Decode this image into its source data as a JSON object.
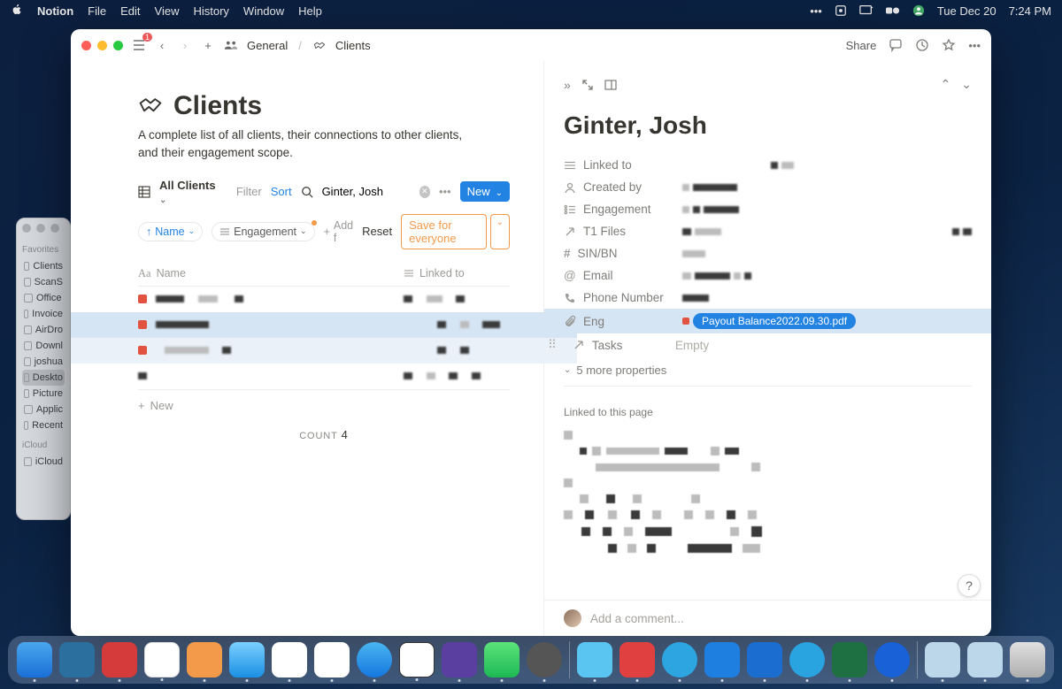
{
  "menubar": {
    "app": "Notion",
    "items": [
      "File",
      "Edit",
      "View",
      "History",
      "Window",
      "Help"
    ],
    "date": "Tue Dec 20",
    "time": "7:24 PM"
  },
  "finder": {
    "section1": "Favorites",
    "items1": [
      "Clients",
      "ScanS",
      "Office",
      "Invoice",
      "AirDro",
      "Downl",
      "joshua",
      "Deskto",
      "Picture",
      "Applic",
      "Recent"
    ],
    "selected_index": 7,
    "section2": "iCloud",
    "items2": [
      "iCloud"
    ]
  },
  "titlebar": {
    "crumb1": "General",
    "crumb2": "Clients",
    "share": "Share"
  },
  "page": {
    "title": "Clients",
    "description": "A complete list of all clients, their connections to other clients, and their engagement scope."
  },
  "view": {
    "name": "All Clients",
    "filter": "Filter",
    "sort": "Sort",
    "search_value": "Ginter, Josh",
    "new": "New"
  },
  "filters": {
    "name_chip": "Name",
    "engagement_chip": "Engagement",
    "add": "Add f",
    "reset": "Reset",
    "save": "Save for everyone"
  },
  "table": {
    "col1": "Name",
    "col2": "Linked to",
    "new_row": "New",
    "count_label": "COUNT",
    "count": "4"
  },
  "detail": {
    "title": "Ginter, Josh",
    "props": {
      "linked_to": "Linked to",
      "created_by": "Created by",
      "engagement": "Engagement",
      "t1files": "T1 Files",
      "sinbn": "SIN/BN",
      "email": "Email",
      "phone": "Phone Number",
      "eng": "Eng",
      "tasks": "Tasks",
      "tasks_val": "Empty",
      "more": "5 more properties"
    },
    "file_pill": "Payout Balance2022.09.30.pdf",
    "linked_section": "Linked to this page",
    "comment_placeholder": "Add a comment..."
  },
  "help": "?"
}
